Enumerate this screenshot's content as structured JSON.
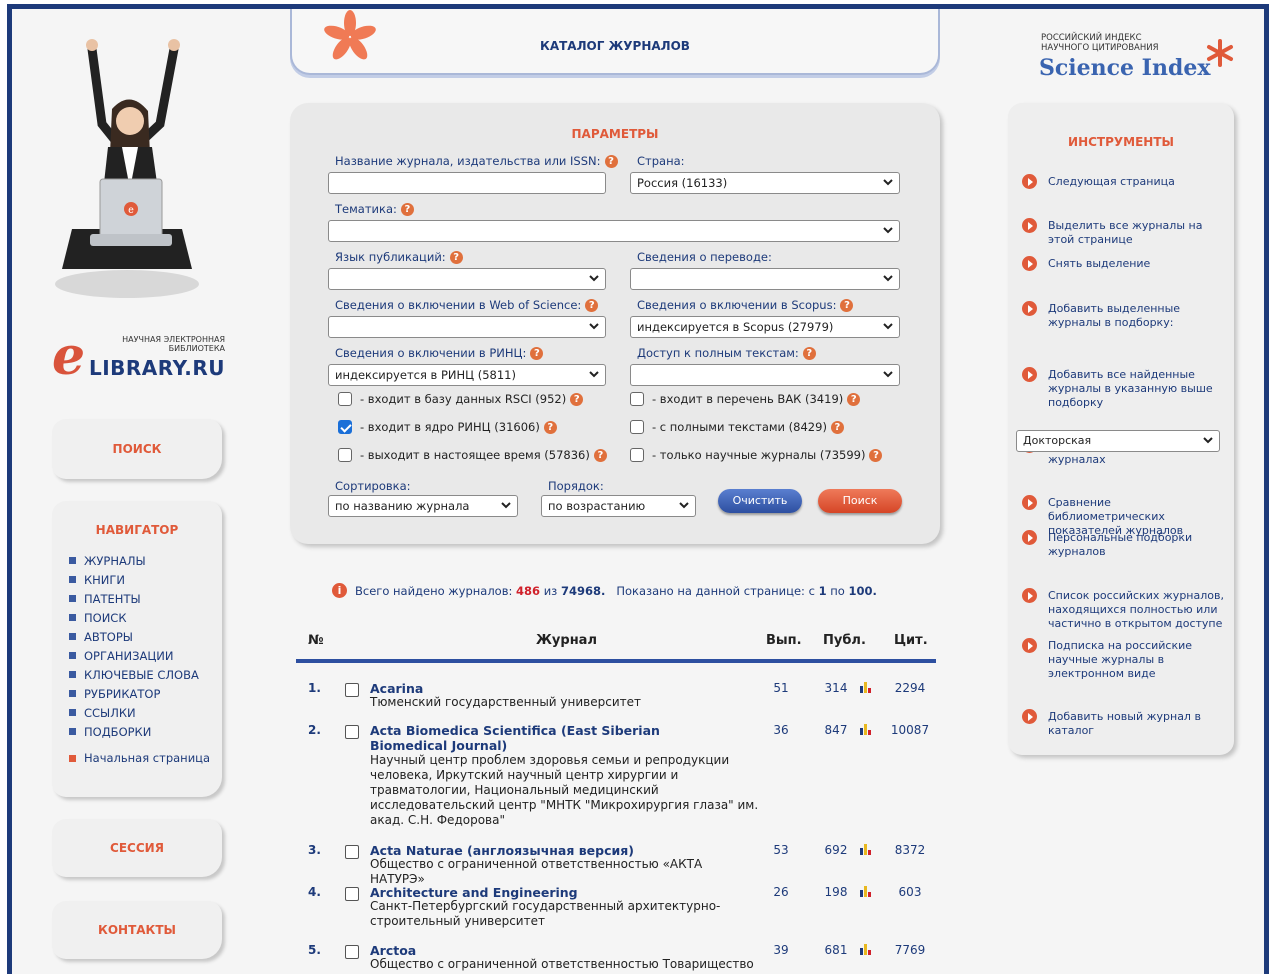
{
  "left": {
    "logo_small": "НАУЧНАЯ ЭЛЕКТРОННАЯ БИБЛИОТЕКА",
    "logo_big": "LIBRARY.RU",
    "logo_e": "e",
    "search_title": "ПОИСК",
    "navigator_title": "НАВИГАТОР",
    "nav_items": [
      "ЖУРНАЛЫ",
      "КНИГИ",
      "ПАТЕНТЫ",
      "ПОИСК",
      "АВТОРЫ",
      "ОРГАНИЗАЦИИ",
      "КЛЮЧЕВЫЕ СЛОВА",
      "РУБРИКАТОР",
      "ССЫЛКИ",
      "ПОДБОРКИ"
    ],
    "home_link": "Начальная страница",
    "session_title": "СЕССИЯ",
    "contacts_title": "КОНТАКТЫ"
  },
  "header": {
    "title": "КАТАЛОГ ЖУРНАЛОВ"
  },
  "params": {
    "title": "ПАРАМЕТРЫ",
    "name_label": "Название журнала, издательства или ISSN:",
    "name_value": "",
    "country_label": "Страна:",
    "country_value": "Россия  (16133)",
    "topic_label": "Тематика:",
    "topic_value": "",
    "lang_label": "Язык публикаций:",
    "lang_value": "",
    "translation_label": "Сведения о переводе:",
    "translation_value": "",
    "wos_label": "Сведения о включении в Web of Science:",
    "wos_value": "",
    "scopus_label": "Сведения о включении в Scopus:",
    "scopus_value": "индексируется в Scopus  (27979)",
    "rinc_label": "Сведения о включении в РИНЦ:",
    "rinc_value": "индексируется в РИНЦ  (5811)",
    "fulltext_label": "Доступ к полным текстам:",
    "fulltext_value": "",
    "checkboxes": [
      {
        "label": "- входит в базу данных RSCI (952)",
        "checked": false
      },
      {
        "label": "- входит в перечень ВАК (3419)",
        "checked": false
      },
      {
        "label": "- входит в ядро РИНЦ (31606)",
        "checked": true
      },
      {
        "label": "- с полными текстами (8429)",
        "checked": false
      },
      {
        "label": "- выходит в настоящее время (57836)",
        "checked": false
      },
      {
        "label": "- только научные журналы (73599)",
        "checked": false
      }
    ],
    "sort_label": "Сортировка:",
    "sort_value": "по названию журнала",
    "order_label": "Порядок:",
    "order_value": "по возрастанию",
    "clear_button": "Очистить",
    "search_button": "Поиск"
  },
  "summary": {
    "prefix": "Всего найдено журналов:",
    "found": "486",
    "of": "из",
    "total": "74968.",
    "shown_prefix": "Показано на данной странице: с",
    "from": "1",
    "to_word": "по",
    "to": "100."
  },
  "table": {
    "col_num": "№",
    "col_journal": "Журнал",
    "col_issues": "Вып.",
    "col_pubs": "Публ.",
    "col_cit": "Цит.",
    "rows": [
      {
        "num": "1.",
        "title": "Acarina",
        "publisher": "Тюменский государственный университет",
        "issues": "51",
        "pubs": "314",
        "cit": "2294"
      },
      {
        "num": "2.",
        "title": "Acta Biomedica Scientifica (East Siberian Biomedical Journal)",
        "publisher": "Научный центр проблем здоровья семьи и репродукции человека, Иркутский научный центр хирургии и травматологии, Национальный медицинский исследовательский центр \"МНТК \"Микрохирургия глаза\" им. акад. С.Н. Федорова\"",
        "issues": "36",
        "pubs": "847",
        "cit": "10087"
      },
      {
        "num": "3.",
        "title": "Acta Naturae (англоязычная версия)",
        "publisher": "Общество с ограниченной ответственностью «АКТА НАТУРЭ»",
        "issues": "53",
        "pubs": "692",
        "cit": "8372"
      },
      {
        "num": "4.",
        "title": "Architecture and Engineering",
        "publisher": "Санкт-Петербургский государственный архитектурно-строительный университет",
        "issues": "26",
        "pubs": "198",
        "cit": "603"
      },
      {
        "num": "5.",
        "title": "Arctoa",
        "publisher": "Общество с ограниченной ответственностью Товарищество",
        "issues": "39",
        "pubs": "681",
        "cit": "7769"
      }
    ]
  },
  "right": {
    "si_small": "РОССИЙСКИЙ ИНДЕКС НАУЧНОГО ЦИТИРОВАНИЯ",
    "si_big": "Science Index",
    "tools_title": "ИНСТРУМЕНТЫ",
    "tools": [
      "Следующая страница",
      "Выделить все журналы на этой странице",
      "Снять выделение",
      "Добавить выделенные журналы в подборку:",
      "Добавить все найденные журналы в указанную выше подборку",
      "Искать в выделенных журналах",
      "Сравнение библиометрических показателей журналов",
      "Персональные подборки журналов",
      "Список российских журналов, находящихся полностью или частично в открытом доступе",
      "Подписка на российские научные журналы в электронном виде",
      "Добавить новый журнал в каталог"
    ],
    "collection_select": "Докторская"
  },
  "colors": {
    "brand_blue": "#1d3a7a",
    "accent_red": "#e05a3a"
  }
}
